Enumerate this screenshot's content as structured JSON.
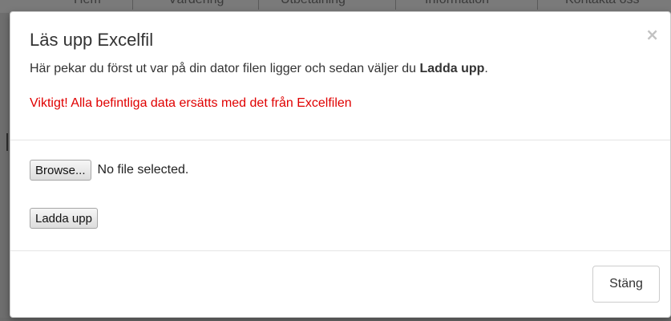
{
  "background": {
    "nav_items": [
      "Hem",
      "Värdering",
      "Utbetalning",
      "Information",
      "Kontakta oss"
    ]
  },
  "modal": {
    "title": "Läs upp Excelfil",
    "close_icon": "×",
    "description_prefix": "Här pekar du först ut var på din dator filen ligger och sedan väljer du ",
    "description_bold": "Ladda upp",
    "description_suffix": ".",
    "warning": "Viktigt! Alla befintliga data ersätts med det från Excelfilen",
    "warning_color": "#e00000",
    "file_input": {
      "browse_label": "Browse...",
      "status": "No file selected."
    },
    "upload_label": "Ladda upp",
    "footer_close_label": "Stäng"
  }
}
